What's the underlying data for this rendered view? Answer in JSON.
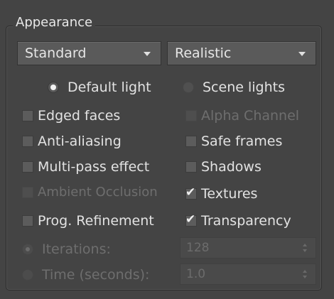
{
  "group": {
    "title": "Appearance"
  },
  "dropdowns": {
    "style": {
      "selected": "Standard",
      "icon": "chevron-down-icon"
    },
    "preset": {
      "selected": "Realistic",
      "icon": "chevron-down-icon"
    }
  },
  "lighting": {
    "default_light": {
      "label": "Default light",
      "selected": true
    },
    "scene_lights": {
      "label": "Scene lights",
      "selected": false
    }
  },
  "left_options": [
    {
      "label": "Edged faces",
      "checked": false,
      "enabled": true
    },
    {
      "label": "Anti-aliasing",
      "checked": false,
      "enabled": true
    },
    {
      "label": "Multi-pass effect",
      "checked": false,
      "enabled": true
    },
    {
      "label": "Ambient Occlusion",
      "checked": false,
      "enabled": false
    },
    {
      "label": "Prog. Refinement",
      "checked": false,
      "enabled": true
    }
  ],
  "right_options": [
    {
      "label": "Alpha Channel",
      "checked": false,
      "enabled": false
    },
    {
      "label": "Safe frames",
      "checked": false,
      "enabled": true
    },
    {
      "label": "Shadows",
      "checked": false,
      "enabled": true
    },
    {
      "label": "Textures",
      "checked": true,
      "enabled": true
    },
    {
      "label": "Transparency",
      "checked": true,
      "enabled": true
    }
  ],
  "refinement": {
    "iterations": {
      "label": "Iterations:",
      "value": "128",
      "enabled": false
    },
    "time": {
      "label": "Time (seconds):",
      "value": "1.0",
      "enabled": false
    }
  },
  "colors": {
    "panel_bg": "#444444",
    "control_bg": "#5a5a5a",
    "text": "#e2e2e2",
    "disabled_text": "#6e6e6e"
  }
}
